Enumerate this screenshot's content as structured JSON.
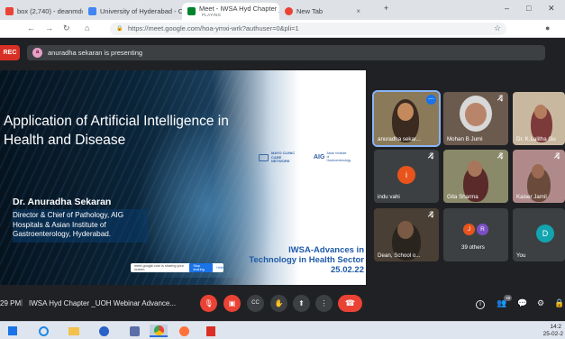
{
  "browser": {
    "tabs": [
      {
        "label": "box (2,740) - deanmd@uohyd",
        "subtitle": ""
      },
      {
        "label": "University of Hyderabad - Cale",
        "subtitle": ""
      },
      {
        "label": "Meet - IWSA Hyd Chapter _UOH",
        "subtitle": "PLAYING"
      },
      {
        "label": "New Tab",
        "subtitle": ""
      }
    ],
    "new_tab_symbol": "+",
    "url": "https://meet.google.com/hoa-ymxi-wrk?authuser=0&pli=1",
    "window_controls": [
      "–",
      "□",
      "✕"
    ]
  },
  "meet": {
    "rec_label": "REC",
    "presenter_initial": "a",
    "presenting_text": "anuradha sekaran is presenting"
  },
  "slide": {
    "title": "Application of Artificial Intelligence in Health and Disease",
    "speaker_name": "Dr. Anuradha Sekaran",
    "speaker_desc": "Director & Chief of Pathology, AIG Hospitals & Asian Institute of Gastroenterology, Hyderabad.",
    "logo_mayo": "MAYO CLINIC CARE NETWORK",
    "logo_aig": "AIG",
    "logo_aig_sub": "Asian Institute of Gastroenterology",
    "event_line1": "IWSA-Advances in",
    "event_line2": "Technology in Health Sector",
    "event_date": "25.02.22",
    "share_text": "meet.google.com is sharing your screen.",
    "share_stop": "Stop sharing",
    "share_hide": "Hide"
  },
  "participants": [
    {
      "name": "anuradha sekar...",
      "avatar_letter": "",
      "avatar_color": ""
    },
    {
      "name": "Mohan B Jumi",
      "avatar_letter": "",
      "avatar_color": ""
    },
    {
      "name": "Dr. K.Lalitha Gu",
      "avatar_letter": "",
      "avatar_color": ""
    },
    {
      "name": "indu vahi",
      "avatar_letter": "i",
      "avatar_color": "#e8541c"
    },
    {
      "name": "Gita Sharma",
      "avatar_letter": "",
      "avatar_color": ""
    },
    {
      "name": "Kaiser Jamil",
      "avatar_letter": "",
      "avatar_color": ""
    },
    {
      "name": "Dean, School o...",
      "avatar_letter": "",
      "avatar_color": ""
    },
    {
      "name": "39 others",
      "avatar_letter": "",
      "avatar_color": ""
    },
    {
      "name": "You",
      "avatar_letter": "D",
      "avatar_color": "#12a4af"
    }
  ],
  "others_avatars": [
    {
      "letter": "J",
      "color": "#e8541c"
    },
    {
      "letter": "R",
      "color": "#7b4fc4"
    }
  ],
  "controls": {
    "time": "29 PM",
    "separator": "|",
    "meeting_title": "IWSA Hyd Chapter _UOH Webinar Advance...",
    "participant_count": "48",
    "info_label": "i",
    "mic_glyph": "🎙",
    "cam_glyph": "▣",
    "cc_glyph": "CC",
    "hand_glyph": "✋",
    "present_glyph": "⬆",
    "more_glyph": "⋮",
    "leave_glyph": "☎",
    "people_glyph": "👥",
    "chat_glyph": "💬",
    "activities_glyph": "⚙",
    "lock_glyph": "🔒"
  },
  "taskbar": {
    "time": "14:2",
    "date": "25-02-2"
  }
}
